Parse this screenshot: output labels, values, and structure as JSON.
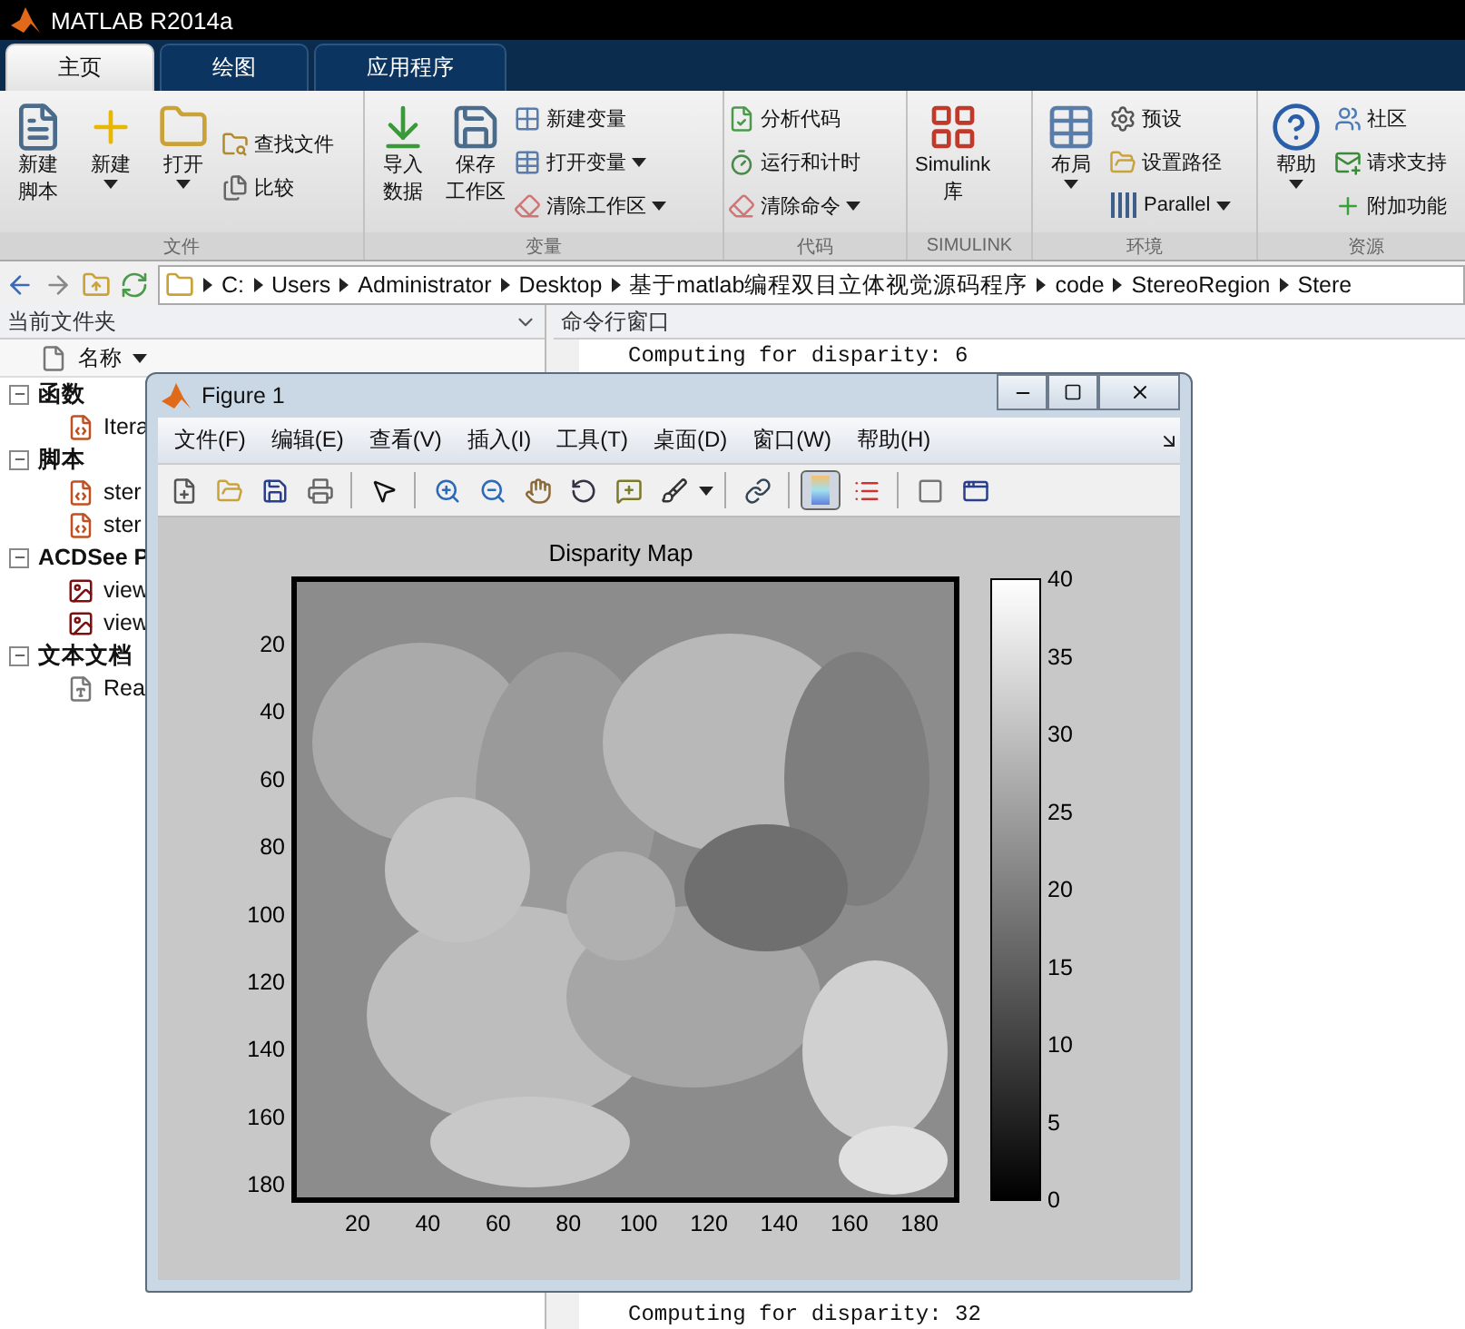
{
  "window": {
    "title": "MATLAB R2014a"
  },
  "tabs": [
    {
      "label": "主页",
      "selected": true
    },
    {
      "label": "绘图",
      "selected": false
    },
    {
      "label": "应用程序",
      "selected": false
    }
  ],
  "ribbon": [
    {
      "label": "文件",
      "items": [
        {
          "kind": "large",
          "lines": [
            "新建",
            "脚本"
          ],
          "dropdown": false
        },
        {
          "kind": "large",
          "lines": [
            "新建"
          ],
          "dropdown": true
        },
        {
          "kind": "large",
          "lines": [
            "打开"
          ],
          "dropdown": true
        },
        {
          "kind": "small",
          "label": "查找文件",
          "dropdown": false
        },
        {
          "kind": "small",
          "label": "比较",
          "dropdown": false
        }
      ]
    },
    {
      "label": "变量",
      "items": [
        {
          "kind": "large",
          "lines": [
            "导入",
            "数据"
          ],
          "dropdown": false
        },
        {
          "kind": "large",
          "lines": [
            "保存",
            "工作区"
          ],
          "dropdown": false
        },
        {
          "kind": "small",
          "label": "新建变量",
          "dropdown": false
        },
        {
          "kind": "small",
          "label": "打开变量",
          "dropdown": true
        },
        {
          "kind": "small",
          "label": "清除工作区",
          "dropdown": true
        }
      ]
    },
    {
      "label": "代码",
      "items": [
        {
          "kind": "small",
          "label": "分析代码",
          "dropdown": false
        },
        {
          "kind": "small",
          "label": "运行和计时",
          "dropdown": false
        },
        {
          "kind": "small",
          "label": "清除命令",
          "dropdown": true
        }
      ]
    },
    {
      "label": "SIMULINK",
      "items": [
        {
          "kind": "large",
          "lines": [
            "Simulink",
            "库"
          ],
          "dropdown": false
        }
      ]
    },
    {
      "label": "环境",
      "items": [
        {
          "kind": "large",
          "lines": [
            "布局"
          ],
          "dropdown": true
        },
        {
          "kind": "small",
          "label": "预设",
          "dropdown": false
        },
        {
          "kind": "small",
          "label": "设置路径",
          "dropdown": false
        },
        {
          "kind": "small",
          "label": "Parallel",
          "dropdown": true
        }
      ]
    },
    {
      "label": "资源",
      "items": [
        {
          "kind": "large",
          "lines": [
            "帮助"
          ],
          "dropdown": true
        },
        {
          "kind": "small",
          "label": "社区",
          "dropdown": false
        },
        {
          "kind": "small",
          "label": "请求支持",
          "dropdown": false
        },
        {
          "kind": "small",
          "label": "附加功能",
          "dropdown": false
        }
      ]
    }
  ],
  "address_bar": {
    "path": [
      "C:",
      "Users",
      "Administrator",
      "Desktop",
      "基于matlab编程双目立体视觉源码程序",
      "code",
      "StereoRegion",
      "Stere"
    ]
  },
  "current_folder": {
    "title": "当前文件夹",
    "column": "名称",
    "tree": [
      {
        "label": "函数",
        "expanded": true,
        "children": [
          {
            "label": "Itera"
          }
        ]
      },
      {
        "label": "脚本",
        "expanded": true,
        "children": [
          {
            "label": "ster"
          },
          {
            "label": "ster"
          }
        ]
      },
      {
        "label": "ACDSee P",
        "expanded": true,
        "children": [
          {
            "label": "view"
          },
          {
            "label": "view"
          }
        ]
      },
      {
        "label": "文本文档",
        "expanded": true,
        "children": [
          {
            "label": "Rea"
          }
        ]
      }
    ]
  },
  "command_window": {
    "title": "命令行窗口",
    "lines_top": [
      "Computing for disparity: 6"
    ],
    "lines_bottom": [
      "Computing for disparity: 32"
    ]
  },
  "figure": {
    "title": "Figure 1",
    "menus": [
      "文件(F)",
      "编辑(E)",
      "查看(V)",
      "插入(I)",
      "工具(T)",
      "桌面(D)",
      "窗口(W)",
      "帮助(H)"
    ],
    "toolbar": [
      {
        "pressed": false
      },
      {
        "pressed": false
      },
      {
        "pressed": false
      },
      {
        "pressed": false
      },
      {
        "pressed": false
      },
      {
        "pressed": false
      },
      {
        "pressed": false
      },
      {
        "pressed": false
      },
      {
        "pressed": false
      },
      {
        "pressed": false
      },
      {
        "pressed": false
      },
      {
        "pressed": false
      },
      {
        "pressed": true
      },
      {
        "pressed": false
      },
      {
        "pressed": false
      },
      {
        "pressed": false
      }
    ],
    "plot": {
      "title": "Disparity Map",
      "yticks": [
        "20",
        "40",
        "60",
        "80",
        "100",
        "120",
        "140",
        "160",
        "180"
      ],
      "xticks": [
        "20",
        "40",
        "60",
        "80",
        "100",
        "120",
        "140",
        "160",
        "180"
      ],
      "colorbar_ticks": [
        "40",
        "35",
        "30",
        "25",
        "20",
        "15",
        "10",
        "5",
        "0"
      ]
    }
  }
}
